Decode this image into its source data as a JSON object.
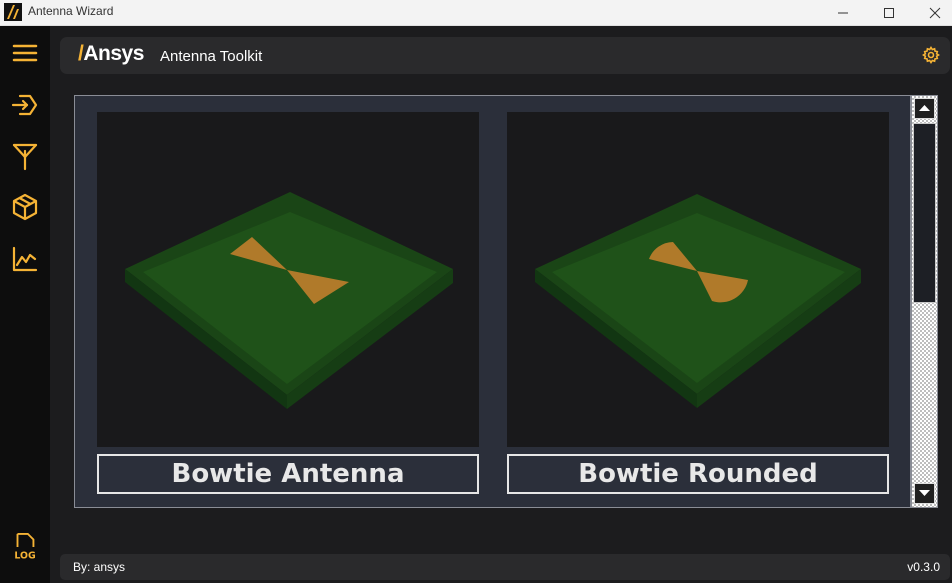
{
  "window": {
    "title": "Antenna Wizard"
  },
  "header": {
    "brand": "Ansys",
    "title": "Antenna Toolkit"
  },
  "cards": [
    {
      "label": "Bowtie Antenna",
      "shape": "bowtie"
    },
    {
      "label": "Bowtie Rounded",
      "shape": "bowtie-rounded"
    }
  ],
  "footer": {
    "by": "By: ansys",
    "version": "v0.3.0"
  },
  "colors": {
    "accent": "#f5b335",
    "substrate": "#1f4a1a",
    "patch": "#b07a2a"
  },
  "icons": [
    "menu-icon",
    "import-icon",
    "antenna-icon",
    "cube-icon",
    "chart-icon",
    "log-icon",
    "gear-icon"
  ],
  "log_label": "LOG"
}
